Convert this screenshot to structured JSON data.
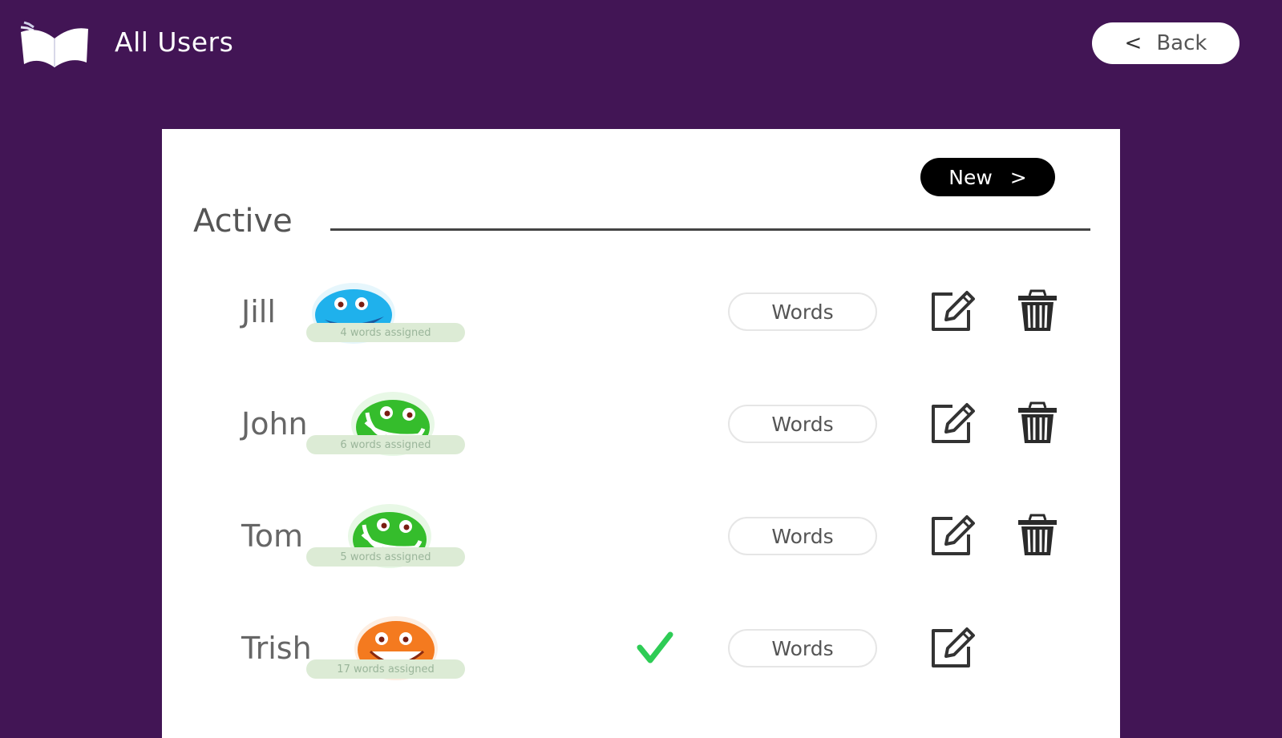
{
  "header": {
    "title": "All Users",
    "logo_icon": "open-book-icon",
    "back_label": "Back",
    "back_icon": "chevron-left-icon"
  },
  "card": {
    "new_label": "New",
    "new_icon": "chevron-right-icon",
    "section_title": "Active"
  },
  "users": [
    {
      "name": "Jill",
      "assigned": "4 words assigned",
      "avatar_color": "#1fb1ec",
      "avatar_icon": "blue-smiley-avatar-icon",
      "selected": false,
      "can_delete": true,
      "words_label": "Words"
    },
    {
      "name": "John",
      "assigned": "6 words assigned",
      "avatar_color": "#35bd2c",
      "avatar_icon": "green-grin-avatar-icon",
      "selected": false,
      "can_delete": true,
      "words_label": "Words"
    },
    {
      "name": "Tom",
      "assigned": "5 words assigned",
      "avatar_color": "#35bd2c",
      "avatar_icon": "green-grin-avatar-icon",
      "selected": false,
      "can_delete": true,
      "words_label": "Words"
    },
    {
      "name": "Trish",
      "assigned": "17 words assigned",
      "avatar_color": "#f47a1f",
      "avatar_icon": "orange-smiley-avatar-icon",
      "selected": true,
      "can_delete": false,
      "words_label": "Words"
    }
  ],
  "colors": {
    "background": "#421555",
    "card": "#ffffff",
    "check": "#2ecc55",
    "assigned_badge": "#dcebd5"
  }
}
